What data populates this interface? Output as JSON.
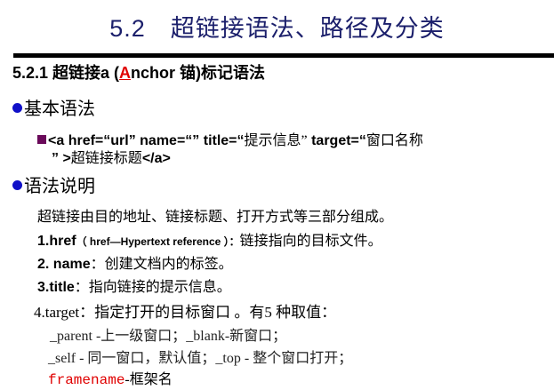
{
  "title": "5.2　超链接语法、路径及分类",
  "subheading": {
    "prefix": "5.2.1 超链接a (",
    "highlight": "A",
    "suffix": "nchor 锚)标记语法"
  },
  "section1": {
    "bullet": "基本语法",
    "code_line1_a": "<a href=“url” name=“” title=“",
    "code_line1_b": "提示信息”",
    "code_line1_c": " target=“",
    "code_line1_d": "窗口名称",
    "code_line2_a": "” >",
    "code_line2_b": "超链接标题",
    "code_line2_c": "</a>"
  },
  "section2": {
    "bullet": "语法说明",
    "intro": "超链接由目的地址、链接标题、打开方式等三部分组成。",
    "item1_label": "1.href",
    "item1_paren": "（ href—Hypertext  reference ）：",
    "item1_text": "链接指向的目标文件。",
    "item2_label": "2. name",
    "item2_text": "：创建文档内的标签。",
    "item3_label": "3.title",
    "item3_text": "：指向链接的提示信息。",
    "item4": "4.target：指定打开的目标窗口 。有5 种取值：",
    "values_line1": "_parent -上一级窗口；_blank-新窗口；",
    "values_line2": "_self - 同一窗口，默认值；_top - 整个窗口打开；",
    "values_line3_red": "framename",
    "values_line3_rest": "-框架名"
  },
  "colors": {
    "title": "#1b1f6b",
    "highlight": "#e00000",
    "bullet": "#1010c8",
    "square": "#6a0a5a"
  }
}
